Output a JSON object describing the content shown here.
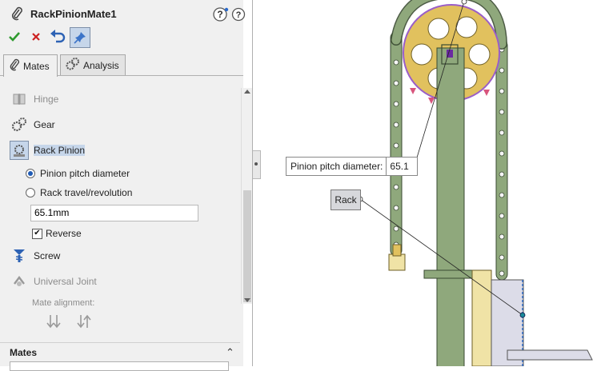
{
  "header": {
    "title": "RackPinionMate1"
  },
  "toolbar": {
    "ok": "ok",
    "cancel": "cancel",
    "undo": "undo",
    "pin": "pin"
  },
  "tabs": [
    {
      "label": "Mates"
    },
    {
      "label": "Analysis"
    }
  ],
  "mate_types": {
    "hinge": "Hinge",
    "gear": "Gear",
    "rack_pinion": "Rack Pinion",
    "screw": "Screw",
    "universal_joint": "Universal Joint"
  },
  "options": {
    "pinion_pitch_diameter": "Pinion pitch diameter",
    "rack_travel": "Rack travel/revolution",
    "value": "65.1mm",
    "reverse": "Reverse",
    "reverse_checked": true,
    "mate_alignment": "Mate alignment:"
  },
  "section": {
    "mates": "Mates"
  },
  "viewport": {
    "callout_label": "Pinion pitch diameter:",
    "callout_value": "65.1",
    "rack_label": "Rack"
  },
  "colors": {
    "gear": "#e1c15e",
    "shaft": "#8fa87c",
    "chain": "#8fa87c",
    "pitch_circle": "#9a5ec8",
    "accent": "#1e5ab4"
  }
}
